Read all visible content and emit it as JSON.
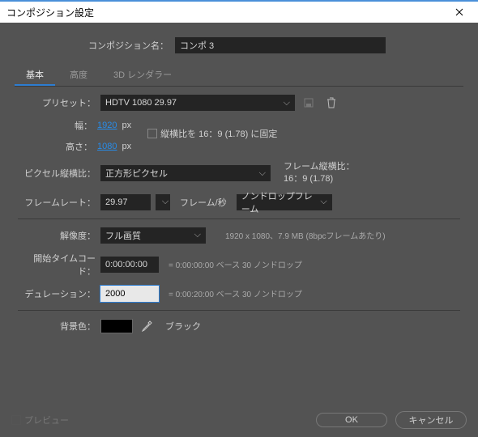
{
  "window": {
    "title": "コンポジション設定"
  },
  "nameRow": {
    "label": "コンポジション名：",
    "value": "コンポ 3"
  },
  "tabs": {
    "basic": "基本",
    "advanced": "高度",
    "renderer": "3D レンダラー"
  },
  "preset": {
    "label": "プリセット：",
    "value": "HDTV 1080 29.97"
  },
  "width": {
    "label": "幅：",
    "value": "1920",
    "unit": "px"
  },
  "height": {
    "label": "高さ：",
    "value": "1080",
    "unit": "px"
  },
  "lockAspect": {
    "label": "縦横比を 16：9 (1.78) に固定"
  },
  "pixelAspect": {
    "label": "ピクセル縦横比：",
    "value": "正方形ピクセル",
    "frameAspect": "フレーム縦横比：\n16：9 (1.78)"
  },
  "frameRate": {
    "label": "フレームレート：",
    "value": "29.97",
    "unit": "フレーム/秒",
    "dropType": "ノンドロップフレーム"
  },
  "resolution": {
    "label": "解像度：",
    "value": "フル画質",
    "info": "1920 x 1080、7.9 MB (8bpcフレームあたり)"
  },
  "startTC": {
    "label": "開始タイムコード：",
    "value": "0:00:00:00",
    "info": "= 0:00:00:00  ベース 30 ノンドロップ"
  },
  "duration": {
    "label": "デュレーション：",
    "value": "2000",
    "info": "= 0:00:20:00  ベース 30 ノンドロップ"
  },
  "bgColor": {
    "label": "背景色：",
    "name": "ブラック"
  },
  "footer": {
    "preview": "プレビュー",
    "ok": "OK",
    "cancel": "キャンセル"
  }
}
